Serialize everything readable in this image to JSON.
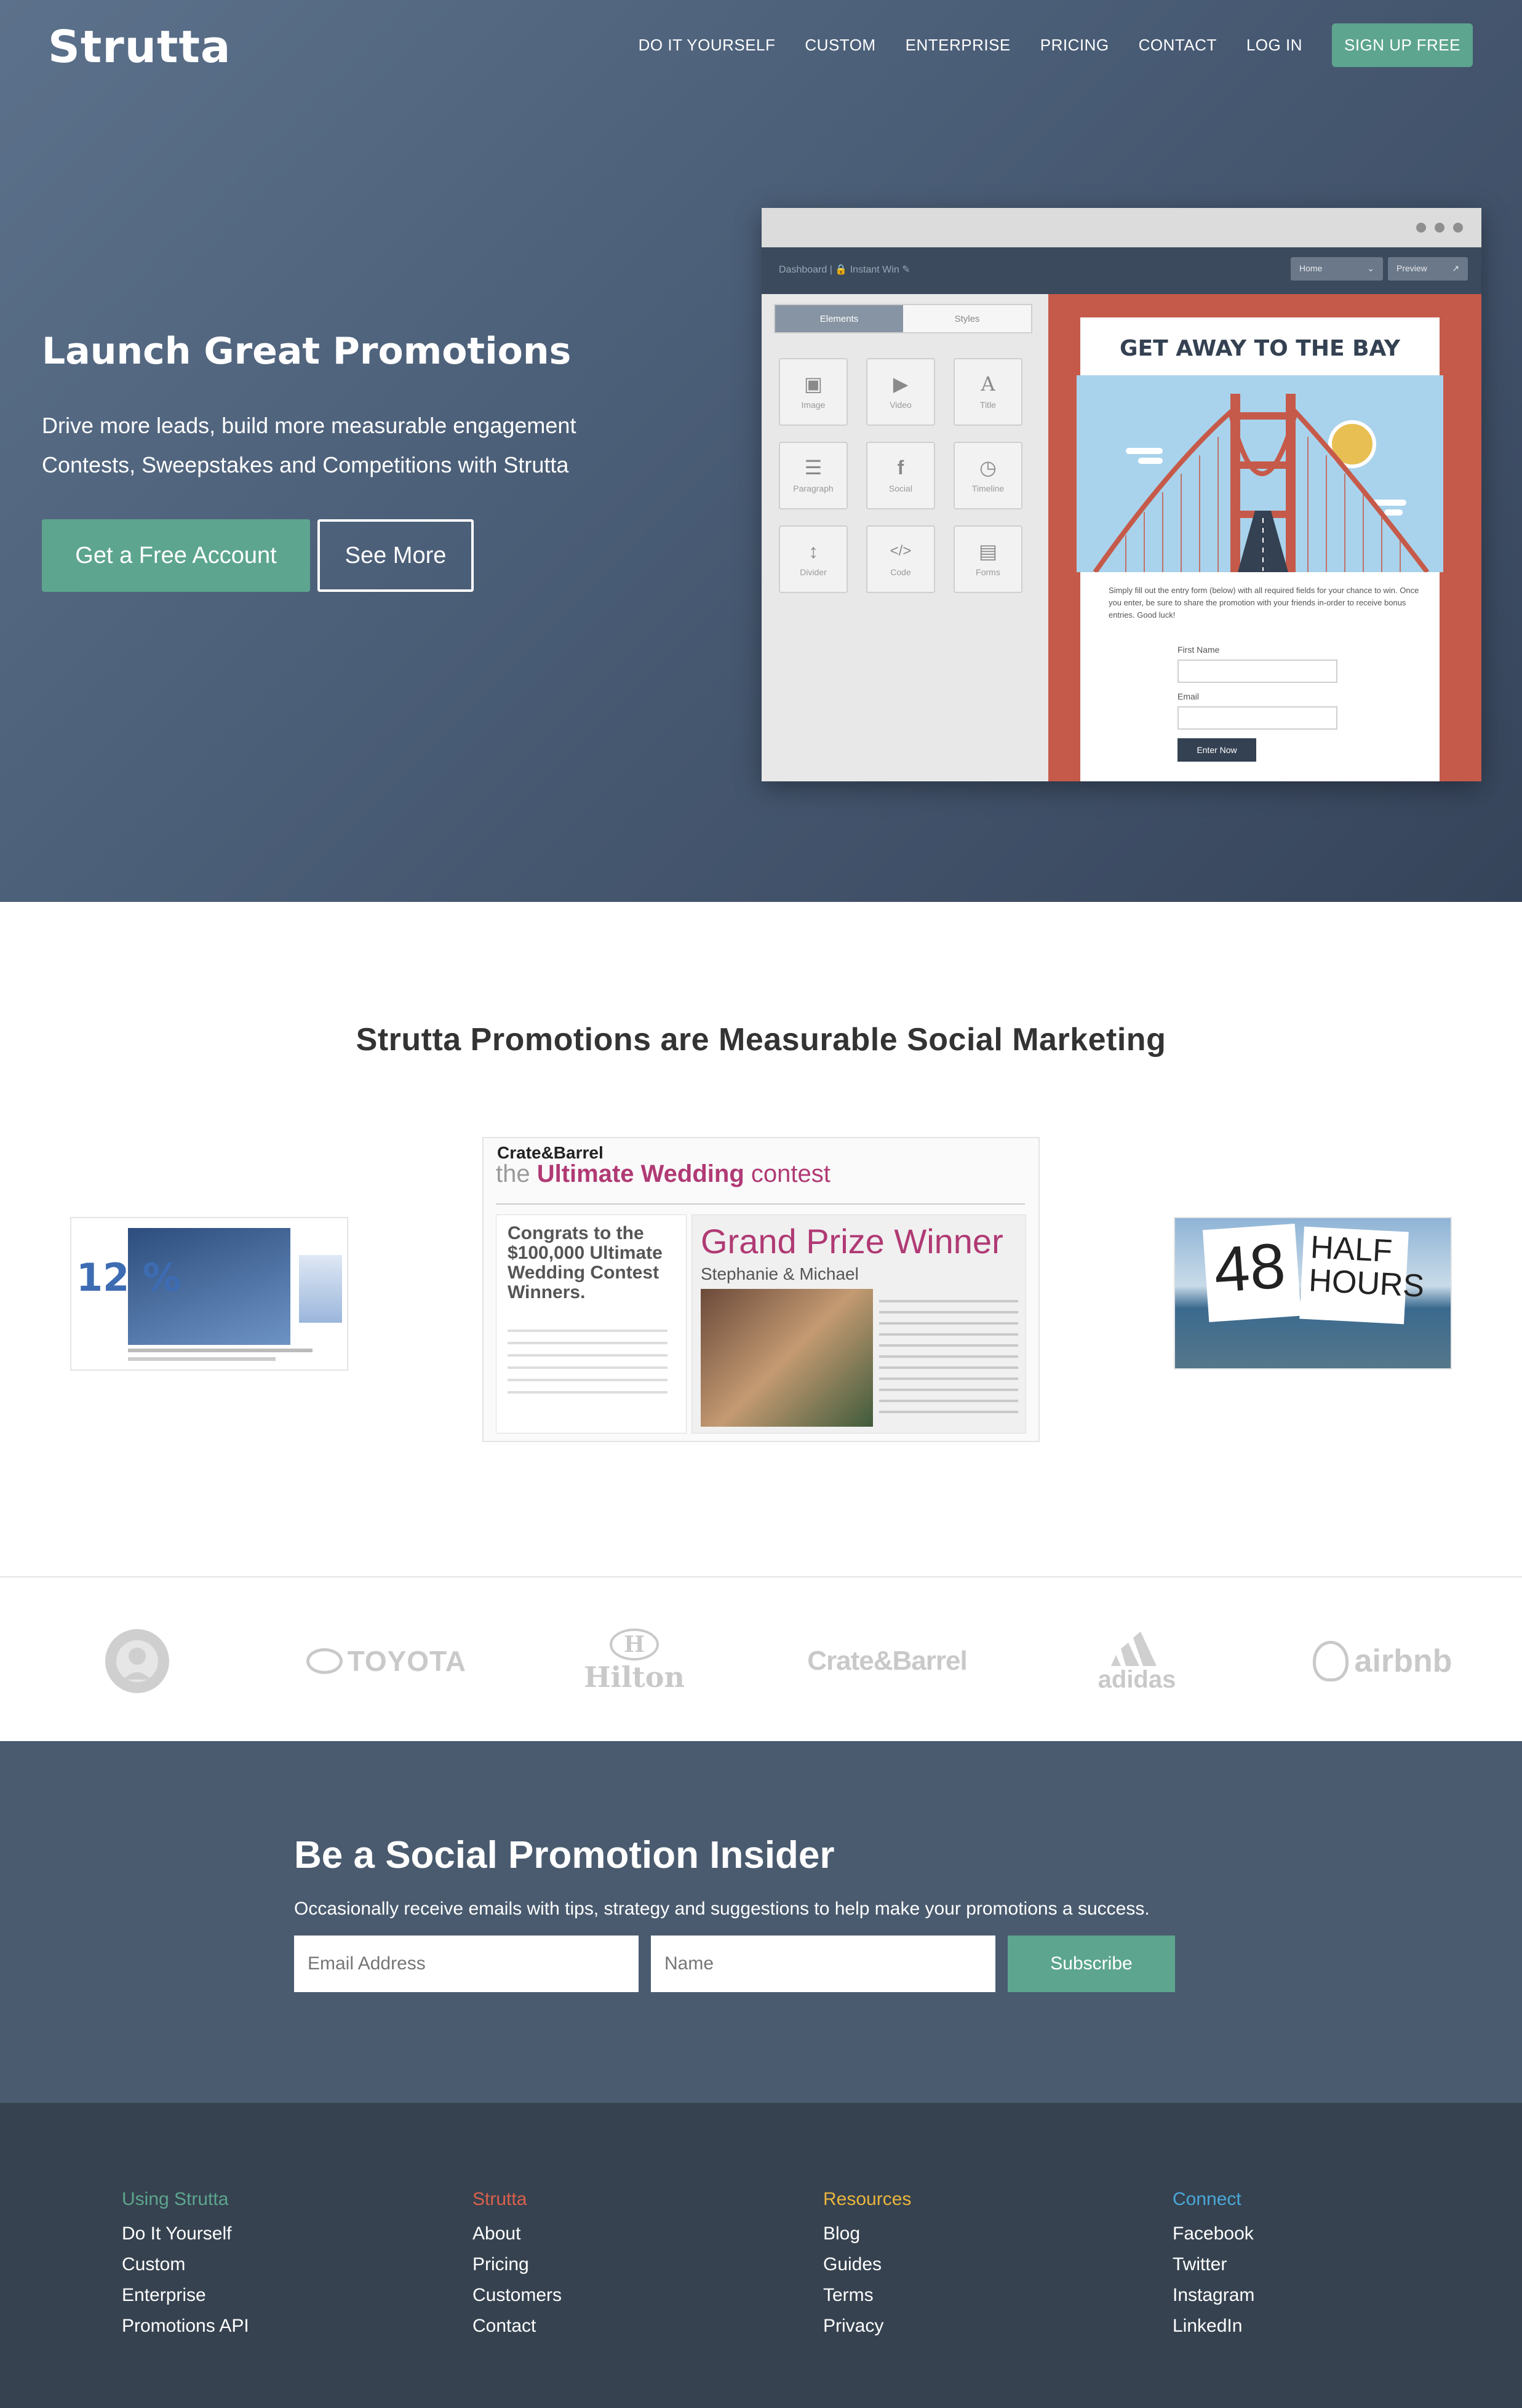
{
  "header": {
    "logo": "Strutta",
    "nav": [
      "DO IT YOURSELF",
      "CUSTOM",
      "ENTERPRISE",
      "PRICING",
      "CONTACT",
      "LOG IN"
    ],
    "signup": "SIGN UP FREE"
  },
  "hero": {
    "title": "Launch Great Promotions",
    "subtitle_line1": "Drive more leads, build more measurable engagement",
    "subtitle_line2": "Contests, Sweepstakes and Competitions with Strutta",
    "cta_primary": "Get a Free Account",
    "cta_secondary": "See More"
  },
  "mockup": {
    "breadcrumb": "Dashboard  |  🔒 Instant Win ✎",
    "page_select": "Home",
    "preview": "Preview",
    "tab_elements": "Elements",
    "tab_styles": "Styles",
    "tiles": [
      "Image",
      "Video",
      "Title",
      "Paragraph",
      "Social",
      "Timeline",
      "Divider",
      "Code",
      "Forms"
    ],
    "card_title": "GET AWAY TO THE BAY",
    "card_body": "Simply fill out the entry form (below) with all required fields for your chance to win. Once you enter, be sure to share the promotion with your friends in-order to receive bonus entries. Good luck!",
    "label_first_name": "First Name",
    "label_email": "Email",
    "enter_button": "Enter Now"
  },
  "showcase": {
    "title": "Strutta Promotions are Measurable Social Marketing",
    "center_brand": "Crate&Barrel",
    "center_heading_prefix": "the ",
    "center_heading_strong": "Ultimate Wedding",
    "center_heading_suffix": " contest",
    "center_left_title": "Congrats to the $100,000 Ultimate Wedding Contest Winners.",
    "center_right_title": "Grand Prize Winner",
    "center_right_names": "Stephanie & Michael",
    "right_number": "48",
    "right_words": "HALF HOURS",
    "left_promo": "12 %"
  },
  "brands": [
    "TOYOTA",
    "Hilton",
    "Crate&Barrel",
    "adidas",
    "airbnb"
  ],
  "newsletter": {
    "title": "Be a Social Promotion Insider",
    "subtitle": "Occasionally receive emails with tips, strategy and suggestions to help make your promotions a success.",
    "email_placeholder": "Email Address",
    "name_placeholder": "Name",
    "button": "Subscribe"
  },
  "footer": {
    "columns": [
      {
        "heading": "Using Strutta",
        "color": "#5da58e",
        "links": [
          "Do It Yourself",
          "Custom",
          "Enterprise",
          "Promotions API"
        ]
      },
      {
        "heading": "Strutta",
        "color": "#d9604c",
        "links": [
          "About",
          "Pricing",
          "Customers",
          "Contact"
        ]
      },
      {
        "heading": "Resources",
        "color": "#e8b53d",
        "links": [
          "Blog",
          "Guides",
          "Terms",
          "Privacy"
        ]
      },
      {
        "heading": "Connect",
        "color": "#4aa7d8",
        "links": [
          "Facebook",
          "Twitter",
          "Instagram",
          "LinkedIn"
        ]
      }
    ]
  },
  "colors": {
    "accent": "#5da58e",
    "hero_dark": "#36445a",
    "newsletter_bg": "#4a5b6f",
    "footer_bg": "#36424f"
  }
}
